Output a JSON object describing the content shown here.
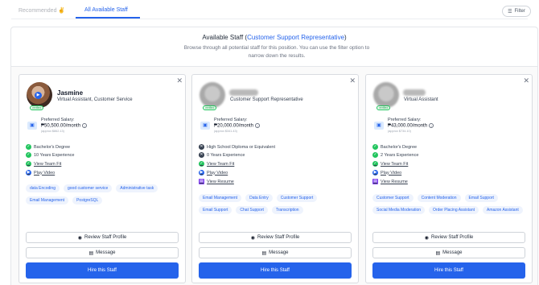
{
  "tabs": {
    "recommended": "Recommended ✌",
    "all": "All Available Staff"
  },
  "filter_label": "Filter",
  "header": {
    "title_prefix": "Available Staff (",
    "title_position": "Customer Support Representative",
    "title_suffix": ")",
    "subtitle": "Browse through all potential staff for this position. You can use the filter option to narrow down the results."
  },
  "common": {
    "verified": "verified",
    "preferred_salary": "Preferred Salary:",
    "review": "Review Staff Profile",
    "message": "Message",
    "hire": "Hire this Staff",
    "view_team_fit": "View Team Fit",
    "play_video": "Play Video",
    "view_resume": "View Resume"
  },
  "cards": [
    {
      "name": "Jasmine",
      "role": "Virtual Assistant, Customer Service",
      "salary": "₱50,500.00/month",
      "approx": "(approx $862.13)",
      "education": "Bachelor's Degree",
      "experience": "10 Years Experience",
      "tags": [
        "data Encoding",
        "good customer service",
        "Administrative task",
        "Email Management",
        "PostgreSQL"
      ]
    },
    {
      "name": "",
      "role": "Customer Support Representative",
      "salary": "₱20,000.00/month",
      "approx": "(approx $341.43)",
      "education": "High School Diploma or Equivalent",
      "experience": "0 Years Experience",
      "tags": [
        "Email Management",
        "Data Entry",
        "Customer Support",
        "Email Support",
        "Chat Support",
        "Transcription"
      ]
    },
    {
      "name": "",
      "role": "Virtual Assistant",
      "salary": "₱43,000.00/month",
      "approx": "(approx $734.10)",
      "education": "Bachelor's Degree",
      "experience": "2 Years Experience",
      "tags": [
        "Customer Support",
        "Content Moderation",
        "Email Support",
        "Social Media Moderation",
        "Order Placing Assistant",
        "Amazon Assistant"
      ]
    }
  ]
}
